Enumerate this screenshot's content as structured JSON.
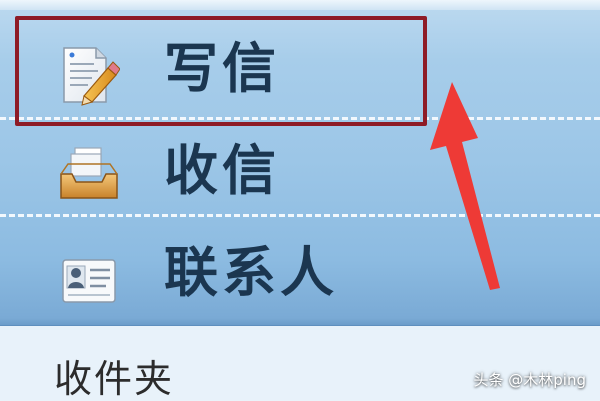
{
  "nav": {
    "items": [
      {
        "id": "compose",
        "label": "写信",
        "icon": "compose-letter-icon"
      },
      {
        "id": "inbox",
        "label": "收信",
        "icon": "inbox-tray-icon"
      },
      {
        "id": "contacts",
        "label": "联系人",
        "icon": "contact-card-icon"
      }
    ]
  },
  "folders": {
    "first_label": "收件夹"
  },
  "annotation": {
    "highlight_color": "#8e1b26",
    "arrow_color": "#ee3a36"
  },
  "watermark": {
    "text": "头条 @木林ping"
  },
  "colors": {
    "nav_bg_top": "#bad8ef",
    "nav_bg_bottom": "#7aaad5",
    "label_color": "#1b3650"
  }
}
